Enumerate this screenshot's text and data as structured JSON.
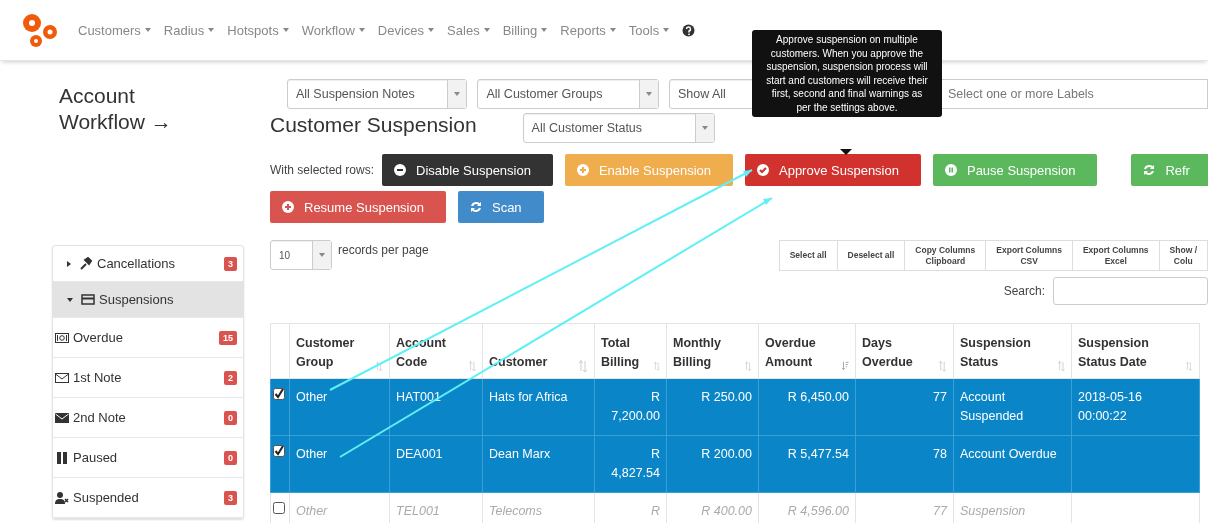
{
  "nav": {
    "items": [
      {
        "label": "Customers"
      },
      {
        "label": "Radius"
      },
      {
        "label": "Hotspots"
      },
      {
        "label": "Workflow"
      },
      {
        "label": "Devices"
      },
      {
        "label": "Sales"
      },
      {
        "label": "Billing"
      },
      {
        "label": "Reports"
      },
      {
        "label": "Tools"
      }
    ]
  },
  "page_title": "Account Workflow →",
  "sidebar": {
    "groups": [
      {
        "label": "Cancellations",
        "kind": "tool",
        "expanded": false,
        "count": "3"
      },
      {
        "label": "Suspensions",
        "kind": "card",
        "expanded": true,
        "children": [
          {
            "label": "Overdue",
            "kind": "money",
            "count": "15"
          },
          {
            "label": "1st Note",
            "kind": "envelope-outline",
            "count": "2"
          },
          {
            "label": "2nd Note",
            "kind": "envelope",
            "count": "0"
          },
          {
            "label": "Paused",
            "kind": "pause",
            "count": "0"
          },
          {
            "label": "Suspended",
            "kind": "user",
            "count": "3"
          }
        ]
      }
    ]
  },
  "filters": {
    "row_1": [
      {
        "value": "All Suspension Notes"
      },
      {
        "value": "All Customer Groups"
      },
      {
        "value": "Show All"
      }
    ],
    "labels": {
      "placeholder": "Select one or more Labels"
    },
    "row_2": [
      {
        "value": "All Customer Status"
      }
    ]
  },
  "heading": "Customer Suspension",
  "bulk": {
    "label": "With selected rows:",
    "actions": [
      {
        "label": "Disable Suspension",
        "kind": "minus",
        "color": "#333333"
      },
      {
        "label": "Enable Suspension",
        "kind": "plus",
        "color": "#f0ad4e"
      },
      {
        "label": "Approve Suspension",
        "kind": "check",
        "color": "#d2322d"
      },
      {
        "label": "Pause Suspension",
        "kind": "pause",
        "color": "#5cb85c"
      },
      {
        "label": "Refr",
        "kind": "refresh",
        "color": "#5cb85c"
      },
      {
        "label": "Resume Suspension",
        "kind": "plus",
        "color": "#d9534f"
      },
      {
        "label": "Scan",
        "kind": "refresh",
        "color": "#428bca"
      }
    ]
  },
  "tooltip": "Approve suspension on multiple customers. When you approve the suspension, suspension process will start and customers will receive their first, second and final warnings as per the settings above.",
  "page_length": {
    "value": "10",
    "label": "records per page"
  },
  "table_tools": [
    "Select all",
    "Deselect all",
    "Copy Columns\nClipboard",
    "Export Columns\nCSV",
    "Export Columns\nExcel",
    "Show /\nColu"
  ],
  "search": {
    "label": "Search:"
  },
  "table": {
    "columns": [
      {
        "label": "Customer Group",
        "kind": "text",
        "sorted": false
      },
      {
        "label": "Account Code",
        "kind": "text",
        "sorted": false
      },
      {
        "label": "Customer",
        "kind": "text",
        "sorted": false
      },
      {
        "label": "Total Billing",
        "kind": "number",
        "sorted": false
      },
      {
        "label": "Monthly Billing",
        "kind": "number",
        "sorted": false
      },
      {
        "label": "Overdue Amount",
        "kind": "number",
        "sorted": true
      },
      {
        "label": "Days Overdue",
        "kind": "number",
        "sorted": false
      },
      {
        "label": "Suspension Status",
        "kind": "text",
        "sorted": false
      },
      {
        "label": "Suspension Status Date",
        "kind": "text",
        "sorted": false
      }
    ],
    "rows": [
      {
        "selected": true,
        "checked": true,
        "inactive": false,
        "cells": [
          "Other",
          "HAT001",
          "Hats for Africa",
          "R 7,200.00",
          "R 250.00",
          "R 6,450.00",
          "77",
          "Account Suspended",
          "2018-05-16 00:00:22"
        ]
      },
      {
        "selected": true,
        "checked": true,
        "inactive": false,
        "cells": [
          "Other",
          "DEA001",
          "Dean Marx",
          "R 4,827.54",
          "R 200.00",
          "R 5,477.54",
          "78",
          "Account Overdue",
          null
        ]
      },
      {
        "selected": false,
        "checked": false,
        "inactive": true,
        "cells": [
          "Other",
          "TEL001",
          "Telecoms",
          "R",
          "R 400.00",
          "R 4,596.00",
          "77",
          "Suspension",
          null
        ]
      }
    ]
  }
}
